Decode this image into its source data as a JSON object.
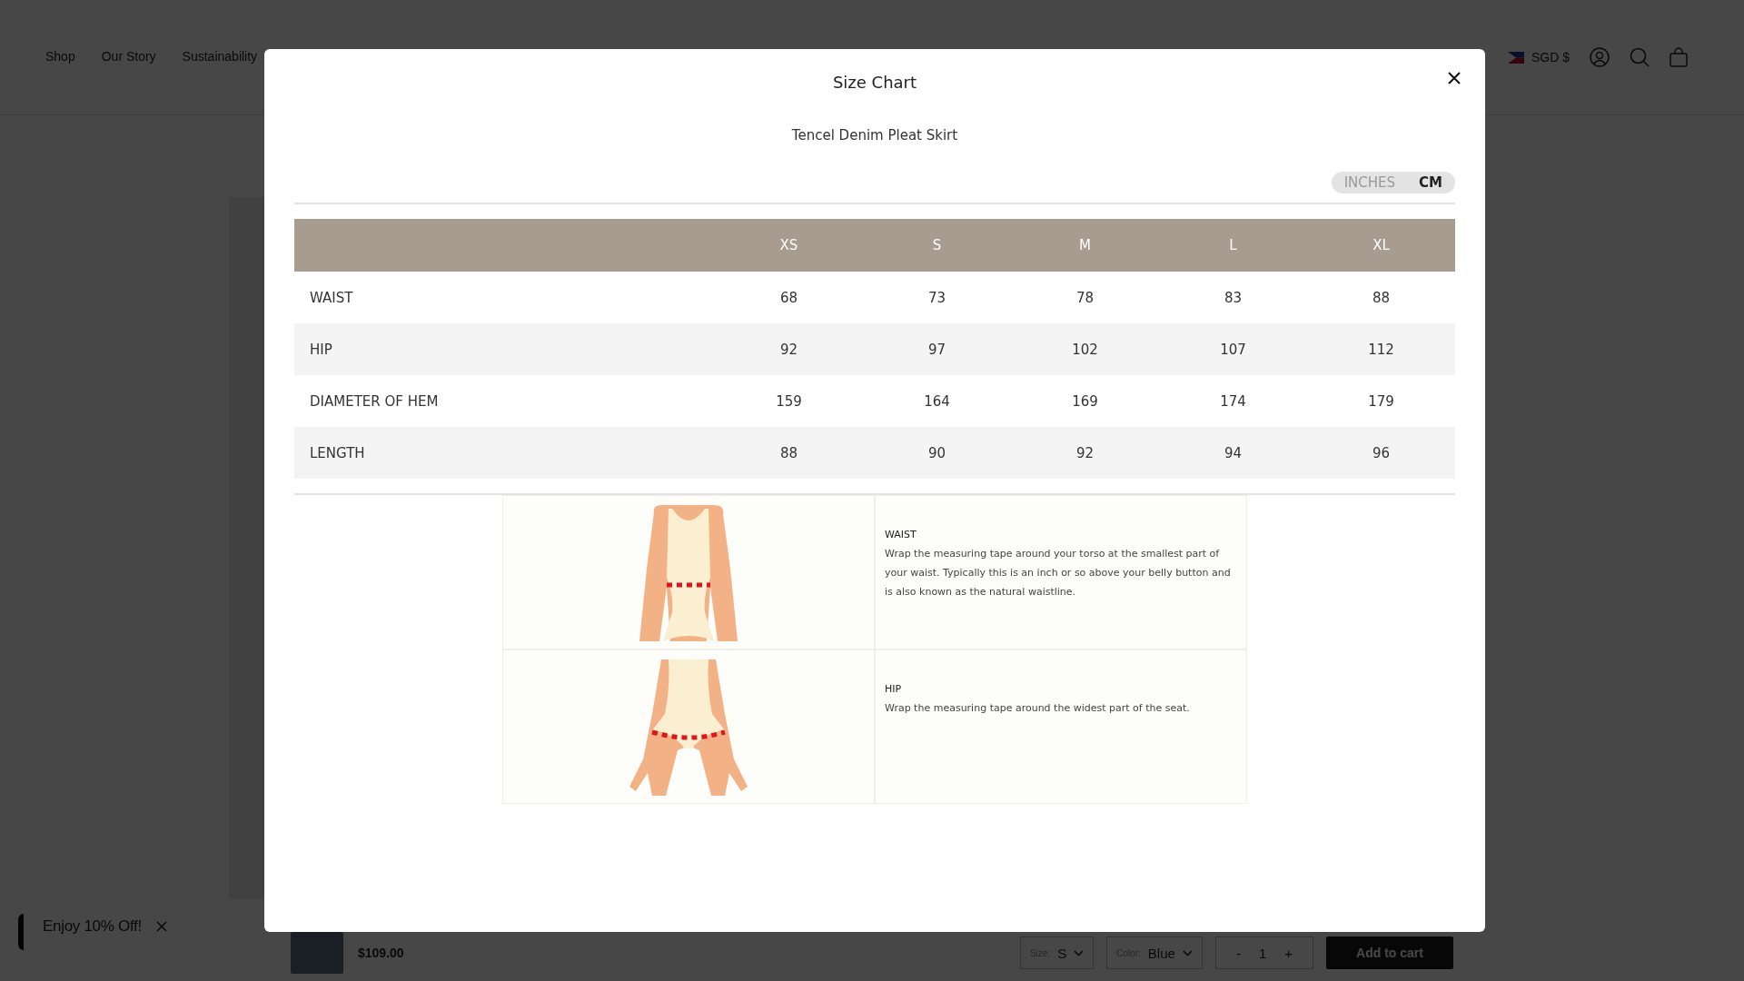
{
  "header": {
    "nav": [
      "Shop",
      "Our Story",
      "Sustainability"
    ],
    "currency": "SGD $"
  },
  "promo": {
    "text": "Enjoy 10% Off!"
  },
  "sticky_bar": {
    "price": "$109.00",
    "size_label": "Size:",
    "size": "S",
    "color_label": "Color:",
    "color_value": "Blue",
    "qty_minus": "-",
    "qty": "1",
    "qty_plus": "+",
    "add_to_cart": "Add to cart"
  },
  "modal": {
    "title": "Size Chart",
    "product": "Tencel Denim Pleat Skirt",
    "units": [
      {
        "label": "INCHES",
        "selected": false
      },
      {
        "label": "CM",
        "selected": true
      }
    ],
    "table": {
      "columns": [
        "XS",
        "S",
        "M",
        "L",
        "XL"
      ],
      "rows": [
        {
          "label": "WAIST",
          "values": [
            "68",
            "73",
            "78",
            "83",
            "88"
          ]
        },
        {
          "label": "HIP",
          "values": [
            "92",
            "97",
            "102",
            "107",
            "112"
          ]
        },
        {
          "label": "DIAMETER OF HEM",
          "values": [
            "159",
            "164",
            "169",
            "174",
            "179"
          ]
        },
        {
          "label": "LENGTH",
          "values": [
            "88",
            "90",
            "92",
            "94",
            "96"
          ]
        }
      ]
    },
    "guide": [
      {
        "kind": "waist",
        "title": "WAIST",
        "text": "Wrap the measuring tape around your torso at the smallest part of your waist. Typically this is an inch or so above your belly button and is also known as the natural waistline."
      },
      {
        "kind": "hip",
        "title": "HIP",
        "text": "Wrap the measuring tape around the widest part of the seat."
      }
    ]
  }
}
